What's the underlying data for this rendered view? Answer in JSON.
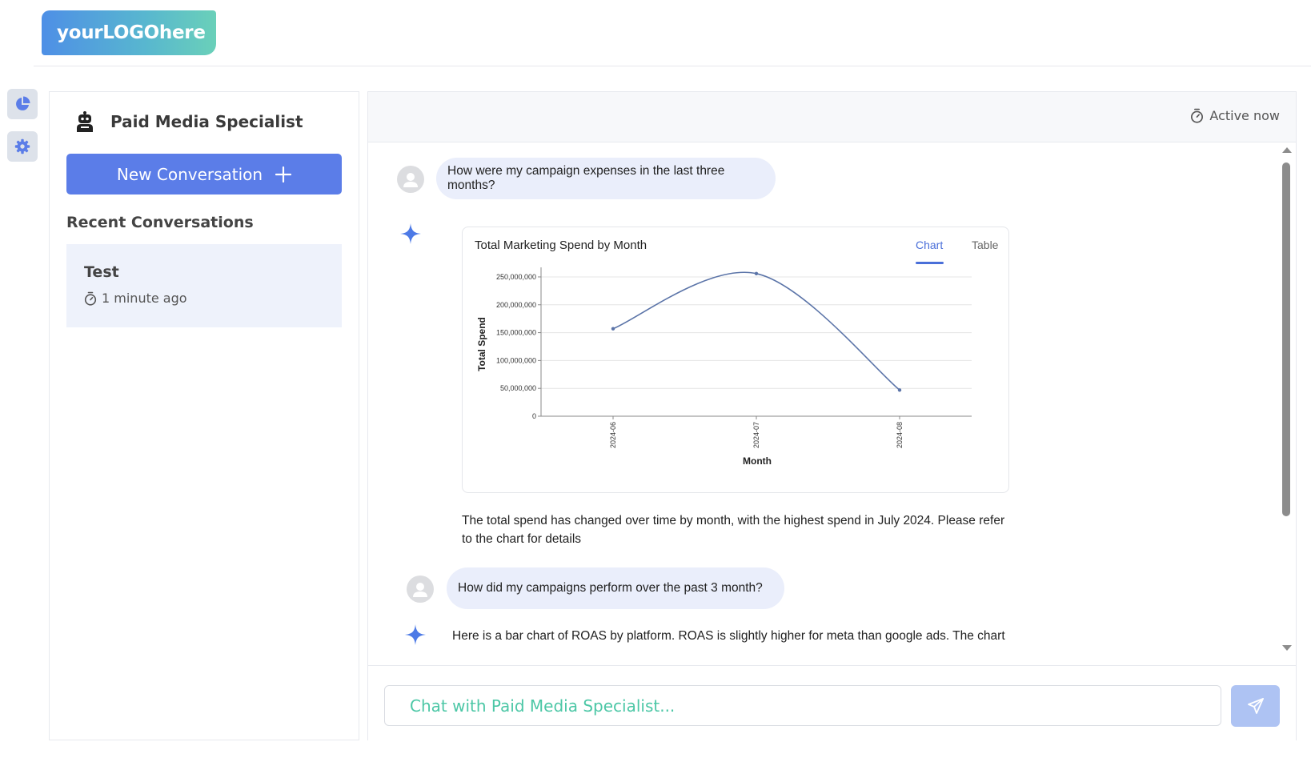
{
  "app": {
    "logo_text": "yourLOGOhere"
  },
  "rail": {
    "items": [
      {
        "icon": "pie-chart-icon"
      },
      {
        "icon": "gear-icon"
      }
    ]
  },
  "sidebar": {
    "agent_name": "Paid Media Specialist",
    "agent_icon": "robot-icon",
    "new_conversation_label": "New Conversation",
    "recent_title": "Recent Conversations",
    "conversations": [
      {
        "title": "Test",
        "time": "1 minute ago"
      }
    ]
  },
  "chat": {
    "status": "Active now",
    "messages": [
      {
        "role": "user",
        "text": "How were my campaign expenses in the last three months?"
      },
      {
        "role": "assistant",
        "type": "chart",
        "text": "The total spend has changed over time by month, with the highest spend in July 2024. Please refer to the chart for details"
      },
      {
        "role": "user",
        "text": "How did my campaigns perform over the past 3 month?"
      },
      {
        "role": "assistant",
        "text": "Here is a bar chart of ROAS by platform. ROAS is slightly higher for meta than google ads. The chart"
      }
    ],
    "chart_tabs": {
      "chart": "Chart",
      "table": "Table"
    },
    "input_placeholder": "Chat with Paid Media Specialist...",
    "input_value": ""
  },
  "chart_data": {
    "type": "line",
    "title": "Total Marketing Spend by Month",
    "xlabel": "Month",
    "ylabel": "Total Spend",
    "categories": [
      "2024-06",
      "2024-07",
      "2024-08"
    ],
    "values": [
      157000000,
      256000000,
      47000000
    ],
    "ylim": [
      0,
      260000000
    ],
    "yticks": [
      0,
      50000000,
      100000000,
      150000000,
      200000000,
      250000000
    ],
    "ytick_labels": [
      "0",
      "50,000,000",
      "100,000,000",
      "150,000,000",
      "200,000,000",
      "250,000,000"
    ],
    "grid": true,
    "line_color": "#5b74a8"
  },
  "colors": {
    "primary": "#5b7de8",
    "accent_text": "#4cc7a6",
    "bubble": "#eaeefb"
  }
}
